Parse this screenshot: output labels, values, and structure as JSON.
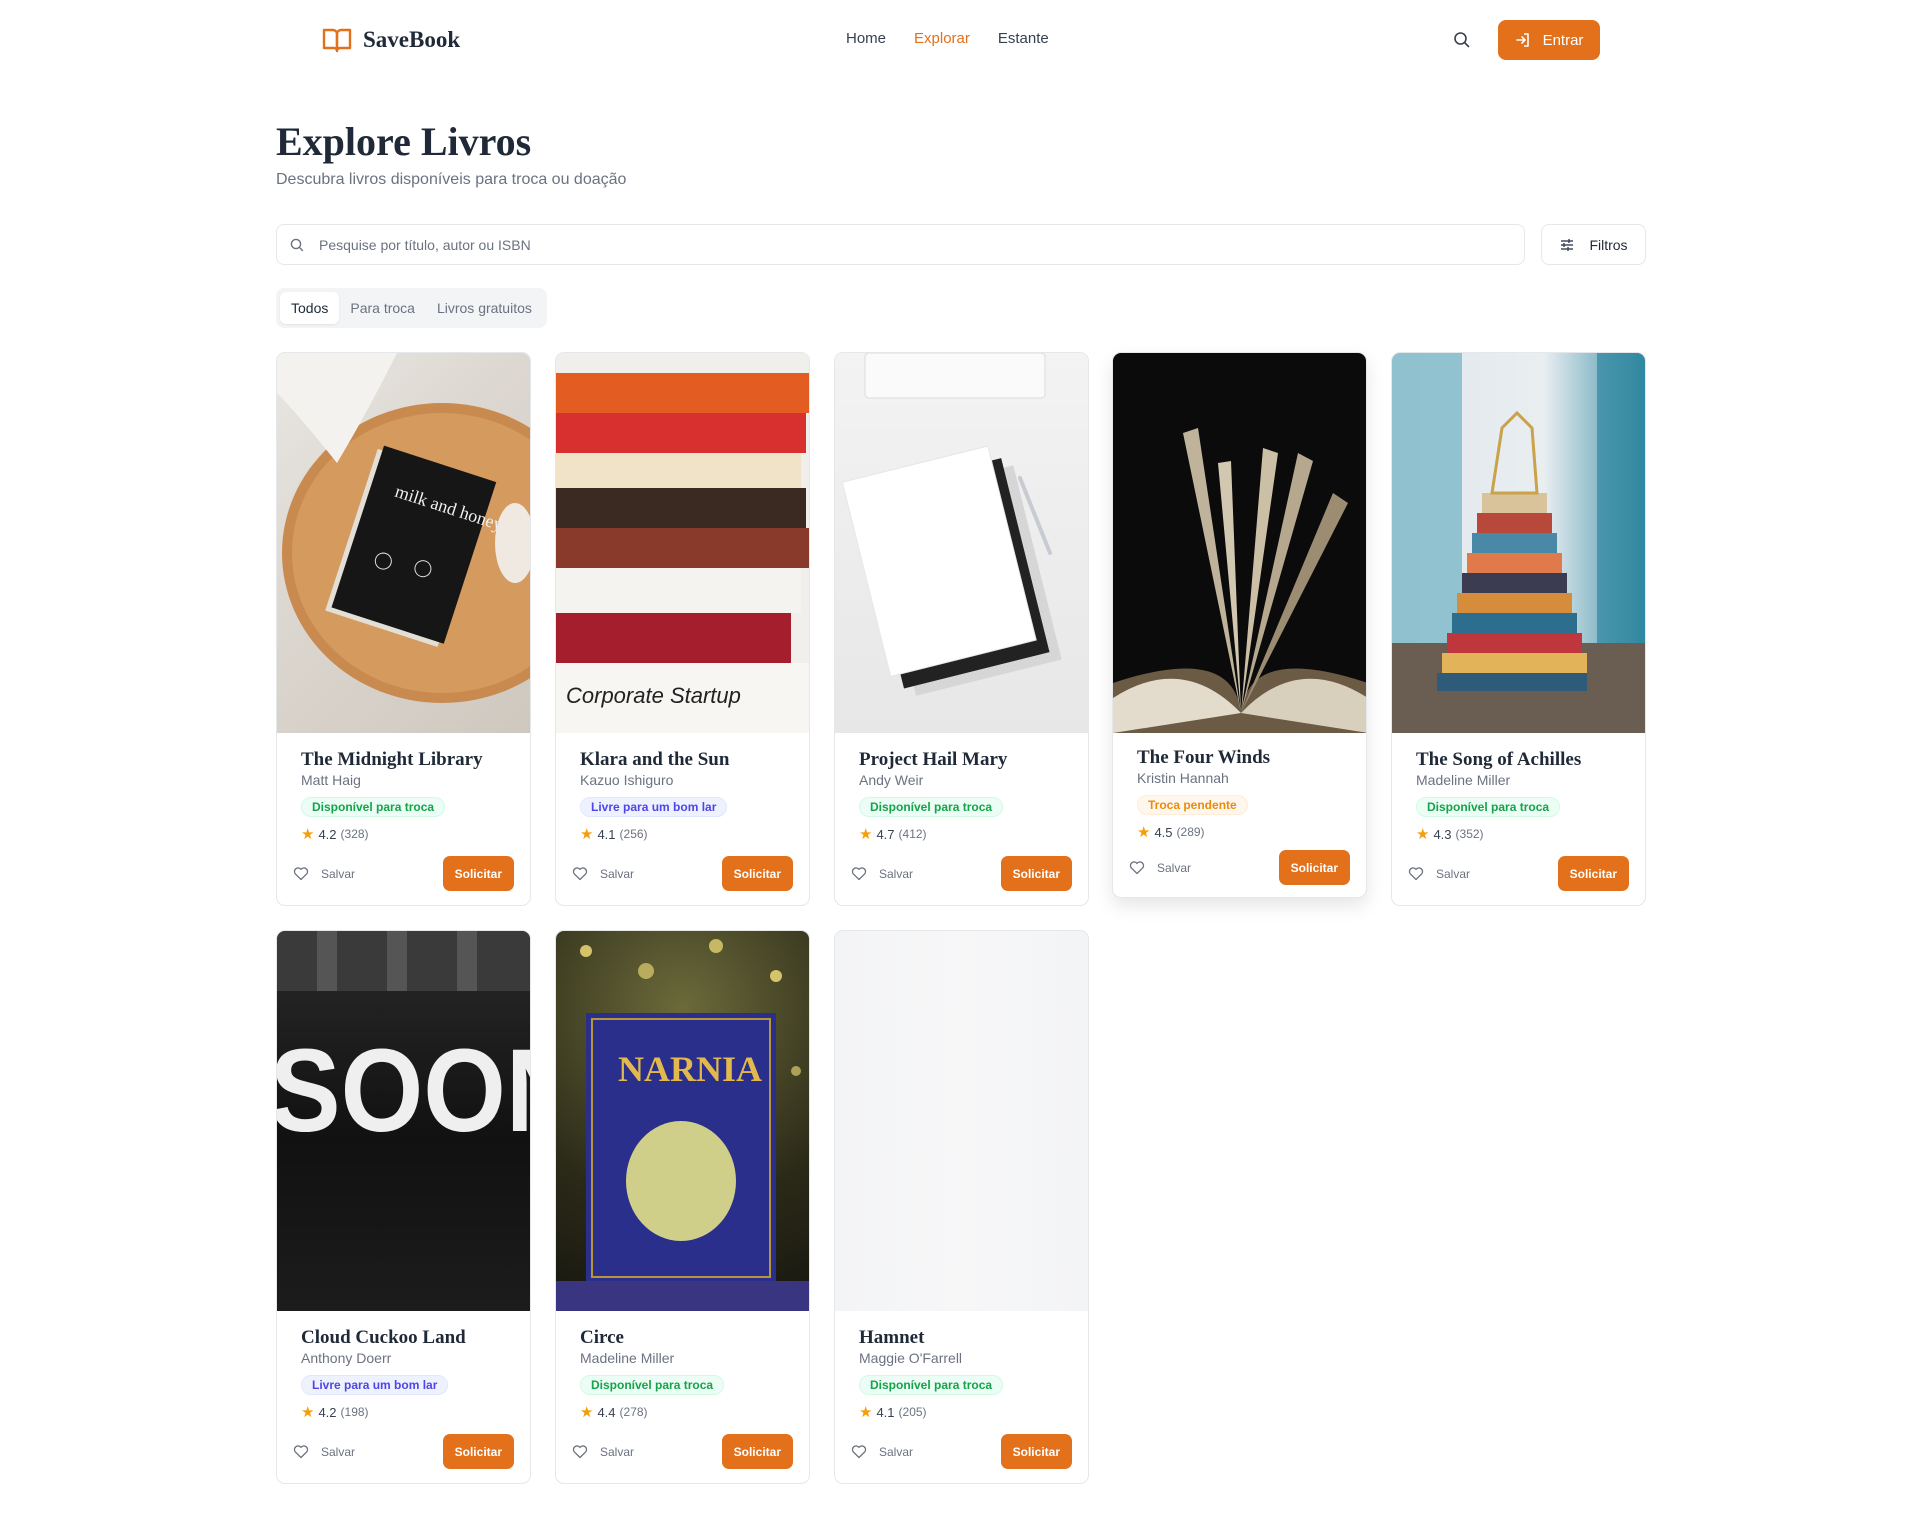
{
  "header": {
    "brand": "SaveBook",
    "nav": [
      {
        "label": "Home"
      },
      {
        "label": "Explorar"
      },
      {
        "label": "Estante"
      }
    ],
    "login_label": "Entrar",
    "accent_color": "#e3701b"
  },
  "page": {
    "title": "Explore Livros",
    "subtitle": "Descubra livros disponíveis para troca ou doação"
  },
  "search": {
    "placeholder": "Pesquise por título, autor ou ISBN",
    "filters_label": "Filtros"
  },
  "tabs": [
    {
      "label": "Todos",
      "active": true
    },
    {
      "label": "Para troca",
      "active": false
    },
    {
      "label": "Livros gratuitos",
      "active": false
    }
  ],
  "books": [
    {
      "title": "The Midnight Library",
      "author": "Matt Haig",
      "badge": "Disponível para troca",
      "rating": "4.2",
      "reviews": "(328)",
      "save": "Salvar",
      "request": "Solicitar",
      "cover_text": "milk and honey"
    },
    {
      "title": "Klara and the Sun",
      "author": "Kazuo Ishiguro",
      "badge": "Livre para um bom lar",
      "rating": "4.1",
      "reviews": "(256)",
      "save": "Salvar",
      "request": "Solicitar",
      "cover_text": "Corporate Startup"
    },
    {
      "title": "Project Hail Mary",
      "author": "Andy Weir",
      "badge": "Disponível para troca",
      "rating": "4.7",
      "reviews": "(412)",
      "save": "Salvar",
      "request": "Solicitar",
      "cover_text": ""
    },
    {
      "title": "The Four Winds",
      "author": "Kristin Hannah",
      "badge": "Troca pendente",
      "rating": "4.5",
      "reviews": "(289)",
      "save": "Salvar",
      "request": "Solicitar",
      "cover_text": ""
    },
    {
      "title": "The Song of Achilles",
      "author": "Madeline Miller",
      "badge": "Disponível para troca",
      "rating": "4.3",
      "reviews": "(352)",
      "save": "Salvar",
      "request": "Solicitar",
      "cover_text": ""
    },
    {
      "title": "Cloud Cuckoo Land",
      "author": "Anthony Doerr",
      "badge": "Livre para um bom lar",
      "rating": "4.2",
      "reviews": "(198)",
      "save": "Salvar",
      "request": "Solicitar",
      "cover_text": "SOON"
    },
    {
      "title": "Circe",
      "author": "Madeline Miller",
      "badge": "Disponível para troca",
      "rating": "4.4",
      "reviews": "(278)",
      "save": "Salvar",
      "request": "Solicitar",
      "cover_text": "NARNIA"
    },
    {
      "title": "Hamnet",
      "author": "Maggie O'Farrell",
      "badge": "Disponível para troca",
      "rating": "4.1",
      "reviews": "(205)",
      "save": "Salvar",
      "request": "Solicitar",
      "cover_text": ""
    }
  ]
}
